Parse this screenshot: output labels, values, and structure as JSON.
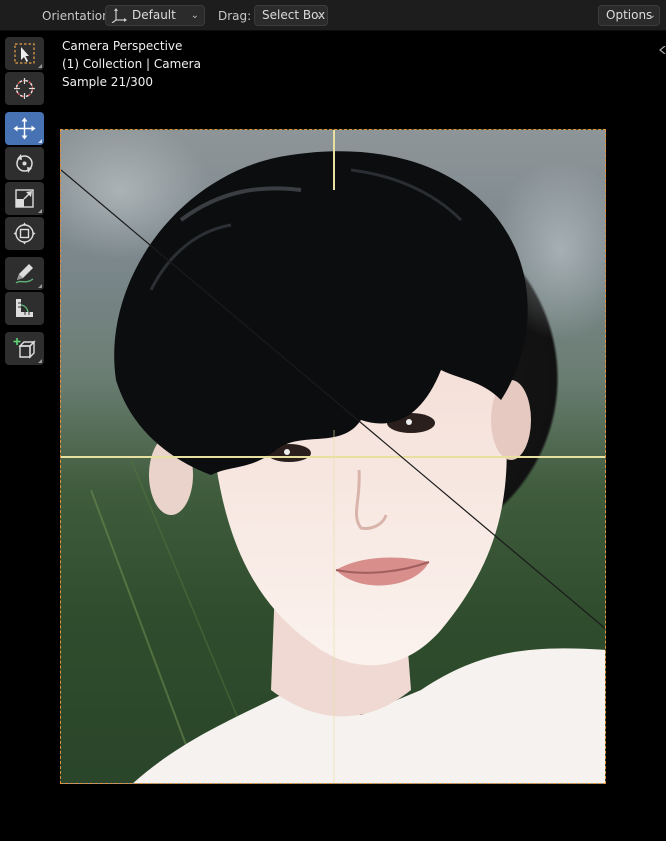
{
  "header": {
    "orientation_label": "Orientation:",
    "orientation_value": "Default",
    "drag_label": "Drag:",
    "drag_value": "Select Box",
    "options_label": "Options"
  },
  "toolbar": {
    "tools": [
      {
        "name": "select-box-tool",
        "icon": "cursor-select-icon",
        "active": false
      },
      {
        "name": "cursor-tool",
        "icon": "3d-cursor-icon",
        "active": false
      },
      {
        "name": "move-tool",
        "icon": "move-arrows-icon",
        "active": true
      },
      {
        "name": "rotate-tool",
        "icon": "rotate-icon",
        "active": false
      },
      {
        "name": "scale-tool",
        "icon": "scale-icon",
        "active": false
      },
      {
        "name": "transform-tool",
        "icon": "transform-icon",
        "active": false
      },
      {
        "name": "annotate-tool",
        "icon": "pencil-icon",
        "active": false
      },
      {
        "name": "measure-tool",
        "icon": "ruler-icon",
        "active": false
      },
      {
        "name": "add-cube-tool",
        "icon": "add-cube-icon",
        "active": false
      }
    ]
  },
  "viewport": {
    "view_name": "Camera Perspective",
    "collection_info": "(1) Collection | Camera",
    "sample_info": "Sample 21/300"
  },
  "colors": {
    "active_tool": "#4772b3",
    "camera_border": "#e0933a",
    "composition_guides": "#e8e0a0"
  }
}
